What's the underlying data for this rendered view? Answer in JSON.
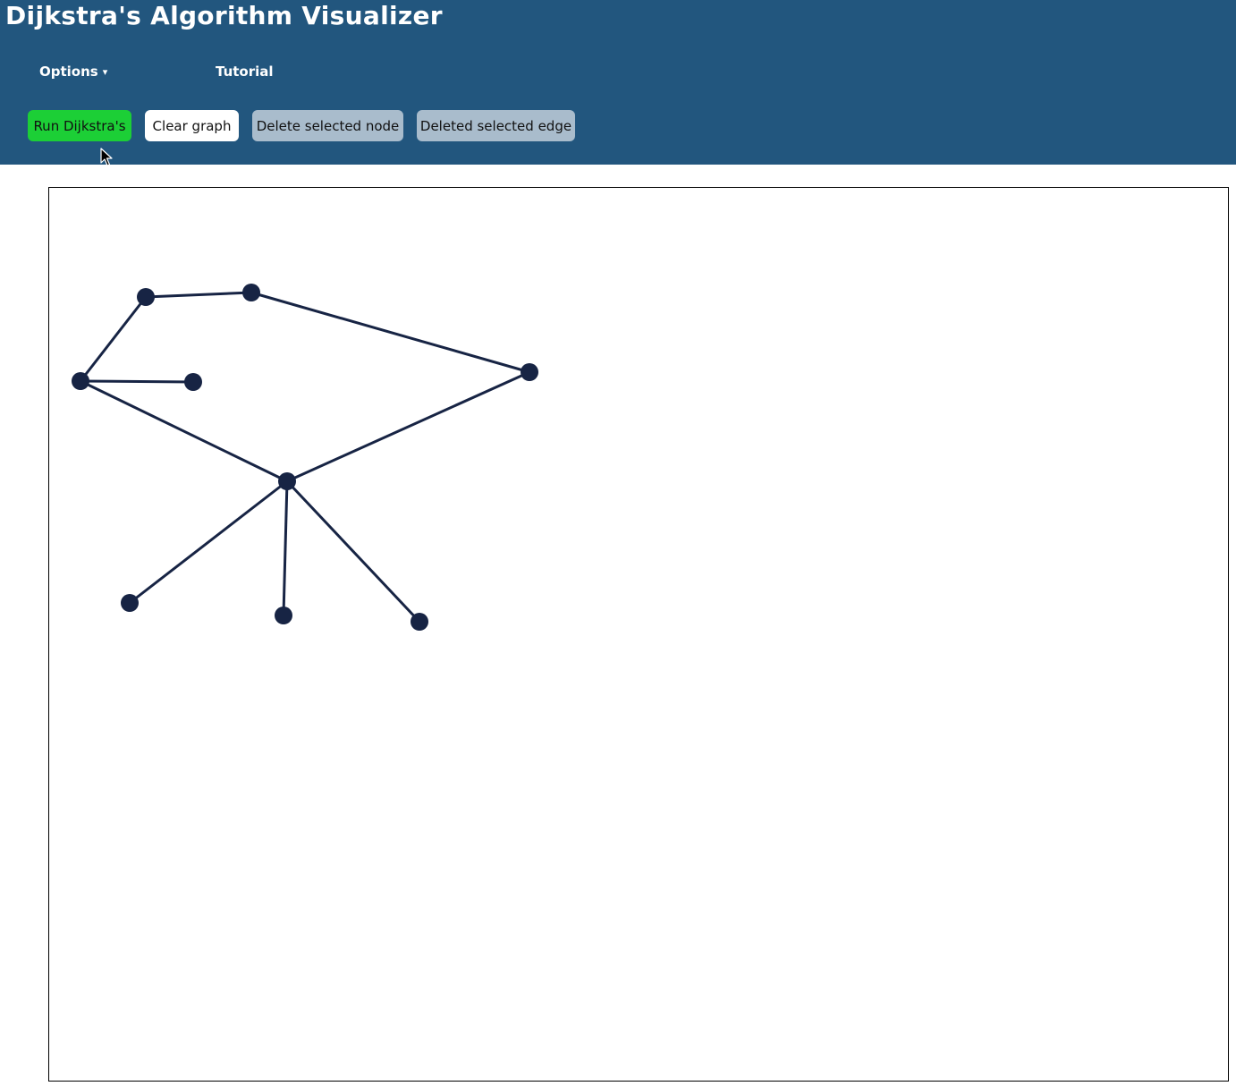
{
  "app": {
    "title": "Dijkstra's Algorithm Visualizer"
  },
  "nav": {
    "options_label": "Options",
    "options_caret": "▾",
    "tutorial_label": "Tutorial"
  },
  "toolbar": {
    "run_label": "Run Dijkstra's",
    "clear_label": "Clear graph",
    "delete_node_label": "Delete selected node",
    "delete_edge_label": "Deleted selected edge"
  },
  "colors": {
    "header_bg": "#22567e",
    "run_button": "#1ccf36",
    "disabled_button": "#a9bccc",
    "node_fill": "#172444",
    "edge_stroke": "#172444"
  },
  "graph": {
    "nodes": [
      {
        "id": "n0"
      },
      {
        "id": "n1"
      },
      {
        "id": "n2"
      },
      {
        "id": "n3"
      },
      {
        "id": "n4"
      },
      {
        "id": "n5"
      },
      {
        "id": "n6"
      },
      {
        "id": "n7"
      },
      {
        "id": "n8"
      }
    ],
    "edges": [
      {
        "from": "n0",
        "to": "n1"
      },
      {
        "from": "n1",
        "to": "n2"
      },
      {
        "from": "n2",
        "to": "n3"
      },
      {
        "from": "n0",
        "to": "n4"
      },
      {
        "from": "n0",
        "to": "n5"
      },
      {
        "from": "n3",
        "to": "n5"
      },
      {
        "from": "n5",
        "to": "n6"
      },
      {
        "from": "n5",
        "to": "n7"
      },
      {
        "from": "n5",
        "to": "n8"
      }
    ]
  }
}
